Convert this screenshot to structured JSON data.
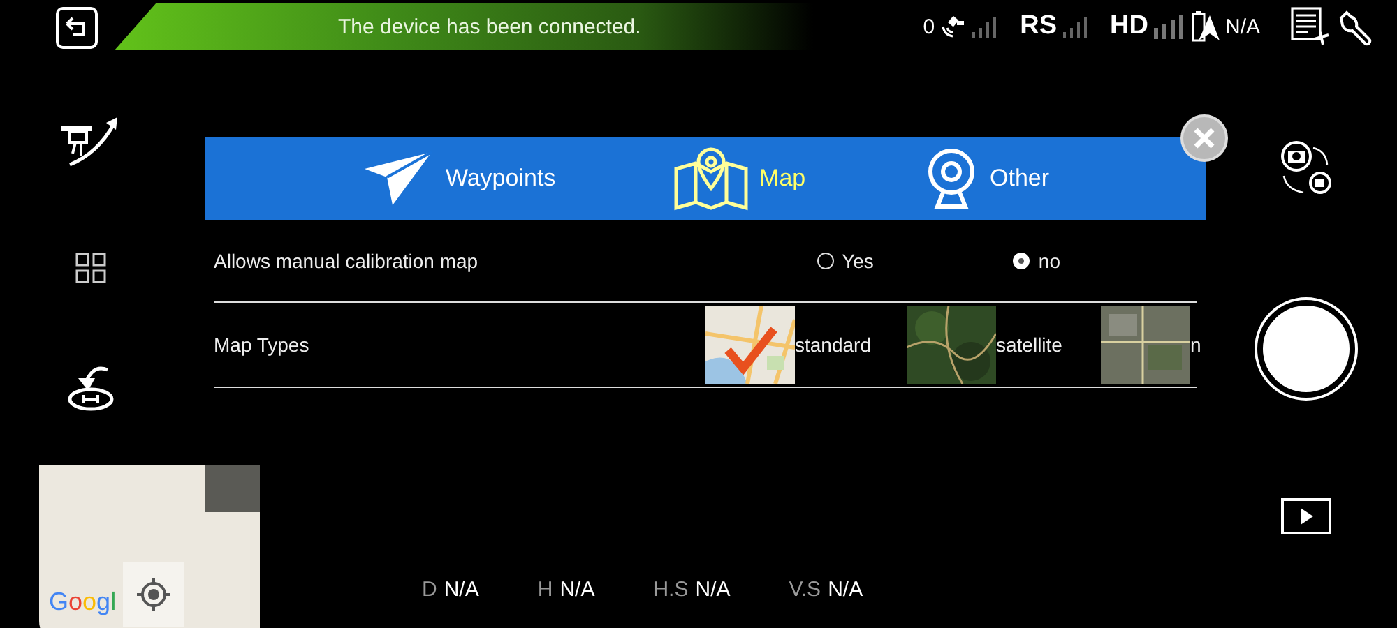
{
  "notification": {
    "text": "The device has been connected."
  },
  "status_bar": {
    "satellites": "0",
    "rc_label": "RS",
    "hd_label": "HD",
    "battery": "N/A"
  },
  "dialog": {
    "tabs": [
      {
        "label": "Waypoints",
        "kind": "plane",
        "selected": false
      },
      {
        "label": "Map",
        "kind": "map",
        "selected": true
      },
      {
        "label": "Other",
        "kind": "camera",
        "selected": false
      }
    ],
    "calibration": {
      "label": "Allows manual calibration map",
      "options": [
        {
          "label": "Yes",
          "selected": false
        },
        {
          "label": "no",
          "selected": true
        }
      ]
    },
    "map_types": {
      "label": "Map Types",
      "items": [
        {
          "label": "standard",
          "kind": "street",
          "selected": true
        },
        {
          "label": "satellite",
          "kind": "satellite",
          "selected": false
        },
        {
          "label": "n",
          "kind": "hybrid",
          "selected": false
        }
      ]
    }
  },
  "mini_map": {
    "attribution": "Googl"
  },
  "telemetry": [
    {
      "label": "D",
      "value": "N/A"
    },
    {
      "label": "H",
      "value": "N/A"
    },
    {
      "label": "H.S",
      "value": "N/A"
    },
    {
      "label": "V.S",
      "value": "N/A"
    }
  ]
}
